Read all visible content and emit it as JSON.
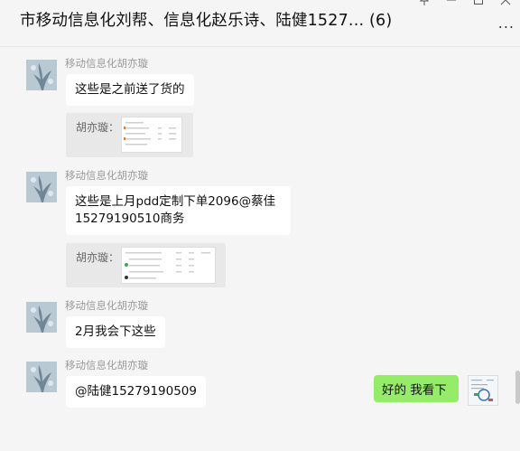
{
  "header": {
    "title": "市移动信息化刘帮、信息化赵乐诗、陆健1527...  (6)",
    "more_label": "...",
    "controls": [
      "pin-icon",
      "minimize-icon",
      "maximize-icon",
      "close-icon"
    ]
  },
  "messages": [
    {
      "sender": "移动信息化胡亦璇",
      "text": "这些是之前送了货的",
      "quote_label": "胡亦璇："
    },
    {
      "sender": "移动信息化胡亦璇",
      "text_line1": "这些是上月pdd定制下单2096@蔡佳",
      "text_line2": "15279190510商务",
      "quote_label": "胡亦璇："
    },
    {
      "sender": "移动信息化胡亦璇",
      "text": "2月我会下这些"
    },
    {
      "sender": "移动信息化胡亦璇",
      "text": "@陆健15279190509"
    }
  ],
  "my_message": {
    "text": "好的 我看下"
  },
  "colors": {
    "my_bubble": "#95ec69",
    "background": "#f5f5f5",
    "bubble": "#ffffff"
  }
}
